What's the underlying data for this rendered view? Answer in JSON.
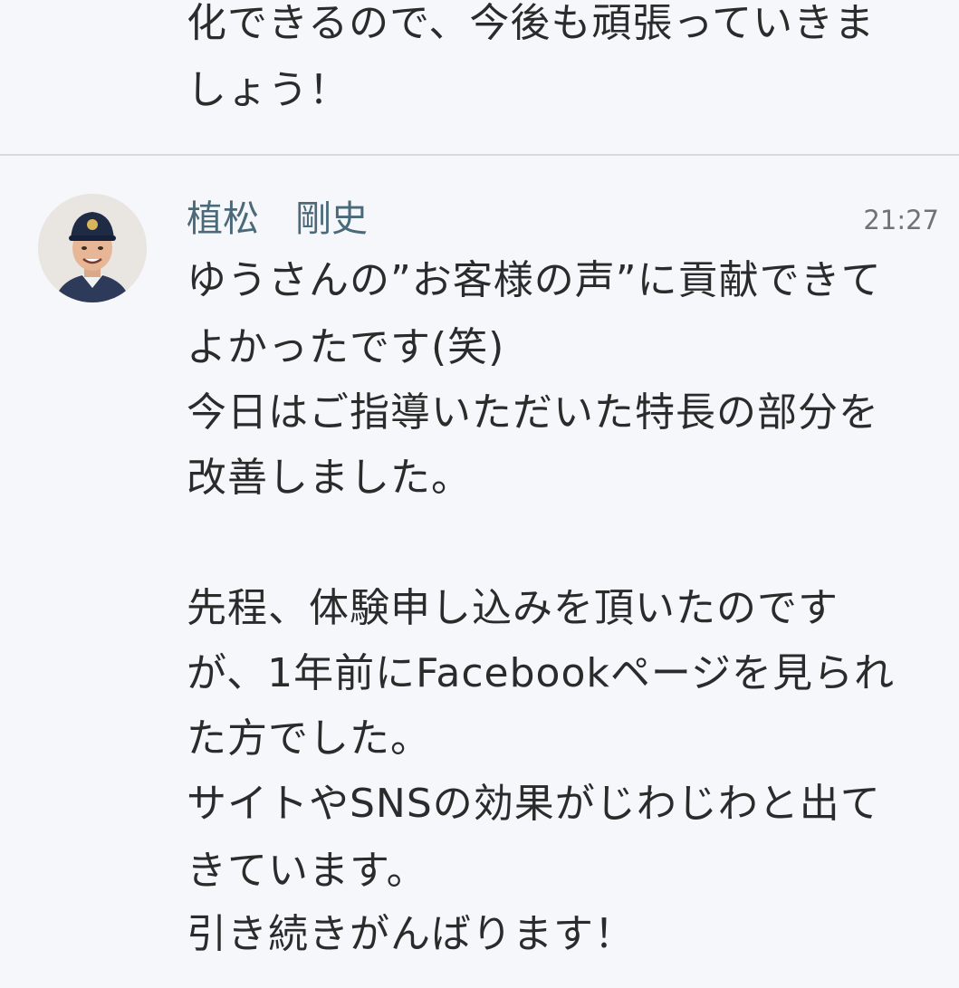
{
  "previous_message": {
    "lines": [
      "化できるので、今後も頑張っていきま",
      "しょう！"
    ]
  },
  "message": {
    "sender_name": "植松　剛史",
    "time": "21:27",
    "avatar_icon": "user-avatar-baseball-cap",
    "lines": [
      "ゆうさんの”お客様の声”に貢献できて",
      "よかったです(笑)",
      "今日はご指導いただいた特長の部分を",
      "改善しました。",
      "",
      "先程、体験申し込みを頂いたのです",
      "が、1年前にFacebookページを見られ",
      "た方でした。",
      "サイトやSNSの効果がじわじわと出て",
      "きています。",
      "引き続きがんばります！"
    ]
  },
  "colors": {
    "background": "#f6f7fa",
    "divider": "#d6d9e0",
    "sender_name": "#4a6a7a",
    "timestamp": "#6e7378",
    "text": "#2b2b2b"
  }
}
